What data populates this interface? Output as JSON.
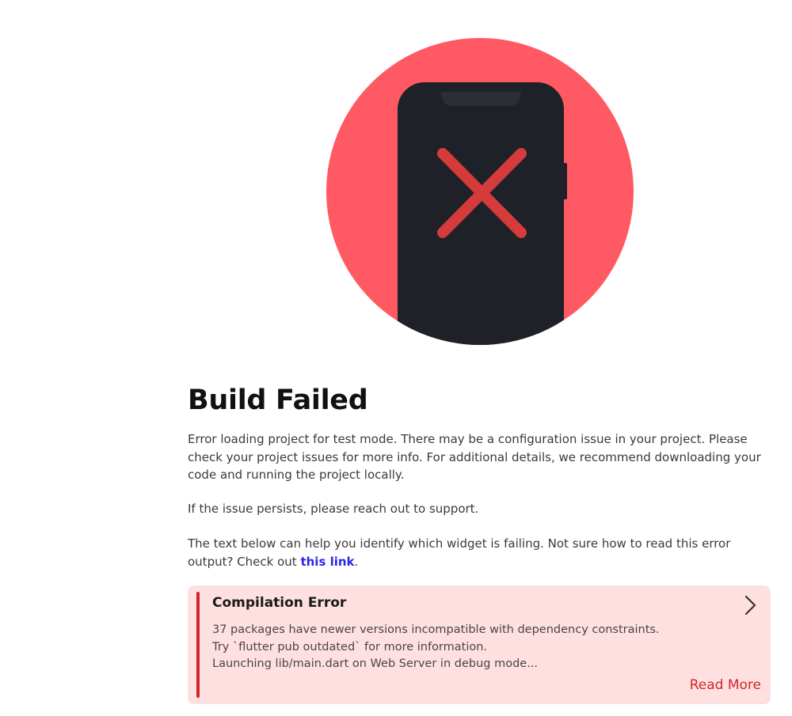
{
  "heading": "Build Failed",
  "messages": {
    "description": "Error loading project for test mode. There may be a configuration issue in your project. Please check your project issues for more info. For additional details, we recommend downloading your code and running the project locally.",
    "support": "If the issue persists, please reach out to support.",
    "help_prefix": "The text below can help you identify which widget is failing. Not sure how to read this error output? Check out ",
    "help_link": "this link",
    "help_suffix": "."
  },
  "error": {
    "title": "Compilation Error",
    "lines": [
      "37 packages have newer versions incompatible with dependency constraints.",
      "Try `flutter pub outdated` for more information.",
      "Launching lib/main.dart on Web Server in debug mode..."
    ],
    "read_more": "Read More"
  },
  "icons": {
    "illustration": "phone-with-red-x-icon",
    "expand": "chevron-right-icon"
  },
  "colors": {
    "circle": "#ff5a64",
    "phone": "#1e2127",
    "cross": "#d63b3b",
    "card_bg": "#ffe0e1",
    "accent": "#d0262b",
    "link": "#2b27e8"
  }
}
